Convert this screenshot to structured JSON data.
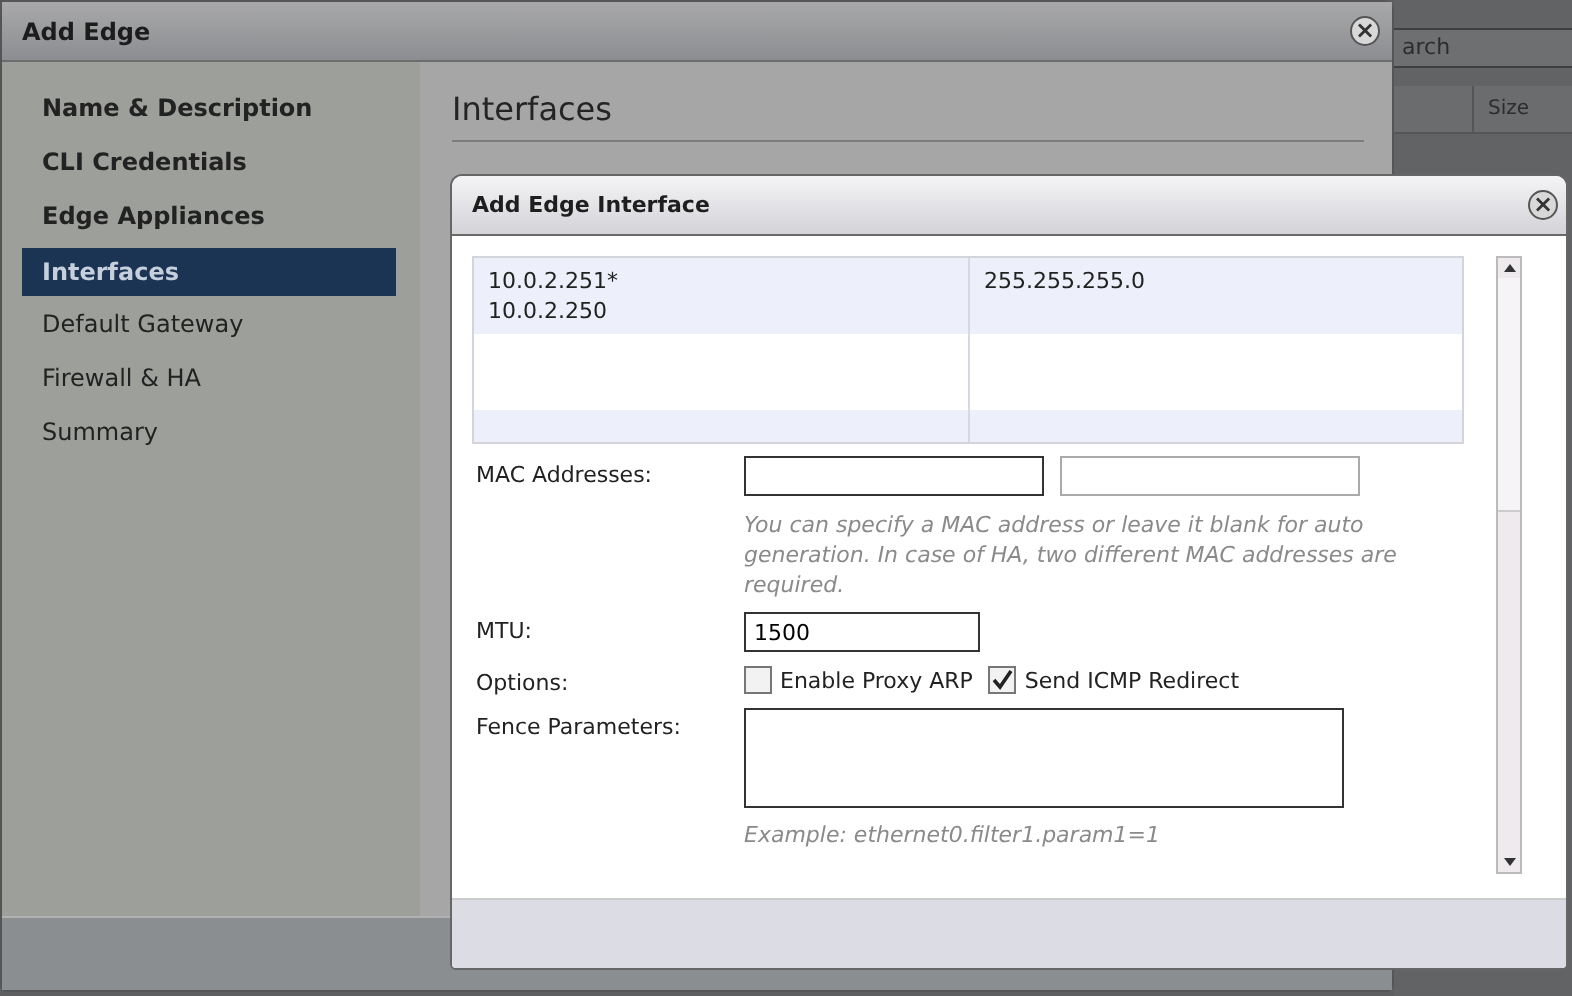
{
  "background": {
    "search_field": {
      "value": "arch"
    },
    "table": {
      "columns": [
        "Size"
      ]
    }
  },
  "window": {
    "title": "Add Edge",
    "close": "×"
  },
  "sidebar": {
    "items": [
      {
        "label": "Name & Description",
        "completed": true,
        "selected": false
      },
      {
        "label": "CLI Credentials",
        "completed": true,
        "selected": false
      },
      {
        "label": "Edge Appliances",
        "completed": true,
        "selected": false
      },
      {
        "label": "Interfaces",
        "completed": true,
        "selected": true
      },
      {
        "label": "Default Gateway",
        "completed": false,
        "selected": false
      },
      {
        "label": "Firewall & HA",
        "completed": false,
        "selected": false
      },
      {
        "label": "Summary",
        "completed": false,
        "selected": false
      }
    ]
  },
  "page": {
    "heading": "Interfaces"
  },
  "dialog": {
    "title": "Add Edge Interface",
    "close": "×",
    "ip_table": {
      "rows": [
        {
          "cells": [
            [
              "10.0.2.251*",
              "10.0.2.250"
            ],
            [
              "255.255.255.0"
            ]
          ]
        }
      ]
    },
    "mac_addresses": {
      "label": "MAC Addresses:",
      "hint": "You can specify a MAC address or leave it blank for auto generation. In case of HA, two different MAC addresses are required."
    },
    "mtu": {
      "label": "MTU:",
      "value": "1500"
    },
    "options": {
      "label": "Options:",
      "checkboxes": [
        {
          "label": "Enable Proxy ARP",
          "checked": false
        },
        {
          "label": "Send ICMP Redirect",
          "checked": true
        }
      ]
    },
    "fence_parameters": {
      "label": "Fence Parameters:",
      "example": "Example: ethernet0.filter1.param1=1"
    }
  }
}
